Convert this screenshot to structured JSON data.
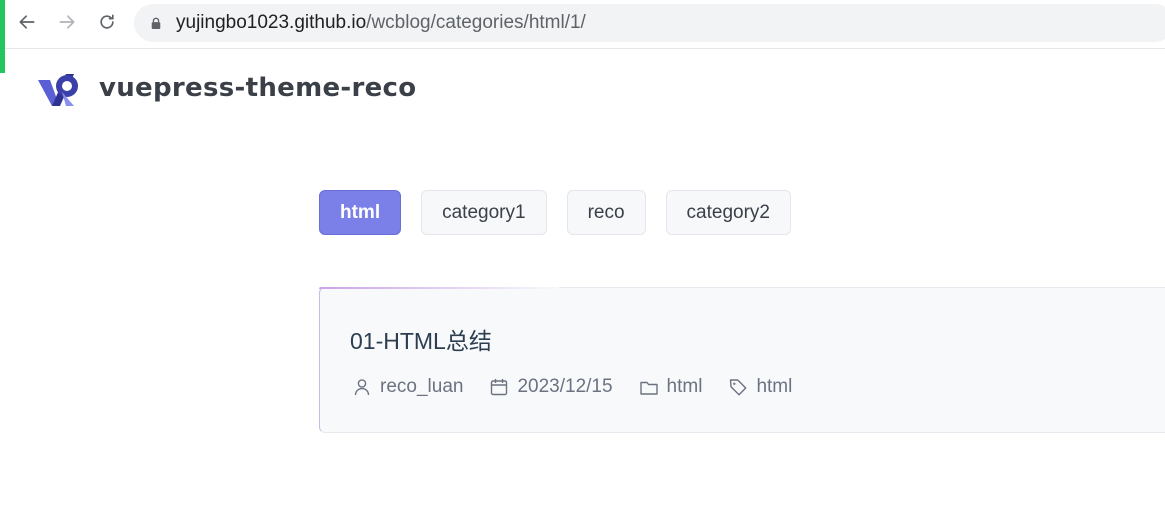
{
  "browser": {
    "url_host": "yujingbo1023.github.io",
    "url_path": "/wcblog/categories/html/1/"
  },
  "site": {
    "title": "vuepress-theme-reco"
  },
  "categories": [
    {
      "label": "html",
      "active": true
    },
    {
      "label": "category1",
      "active": false
    },
    {
      "label": "reco",
      "active": false
    },
    {
      "label": "category2",
      "active": false
    }
  ],
  "post": {
    "title": "01-HTML总结",
    "author": "reco_luan",
    "date": "2023/12/15",
    "category": "html",
    "tag": "html"
  },
  "colors": {
    "accent_strip": "#22c55e",
    "active_tag": "#7b7fe8",
    "logo_primary": "#3b3fa8"
  }
}
